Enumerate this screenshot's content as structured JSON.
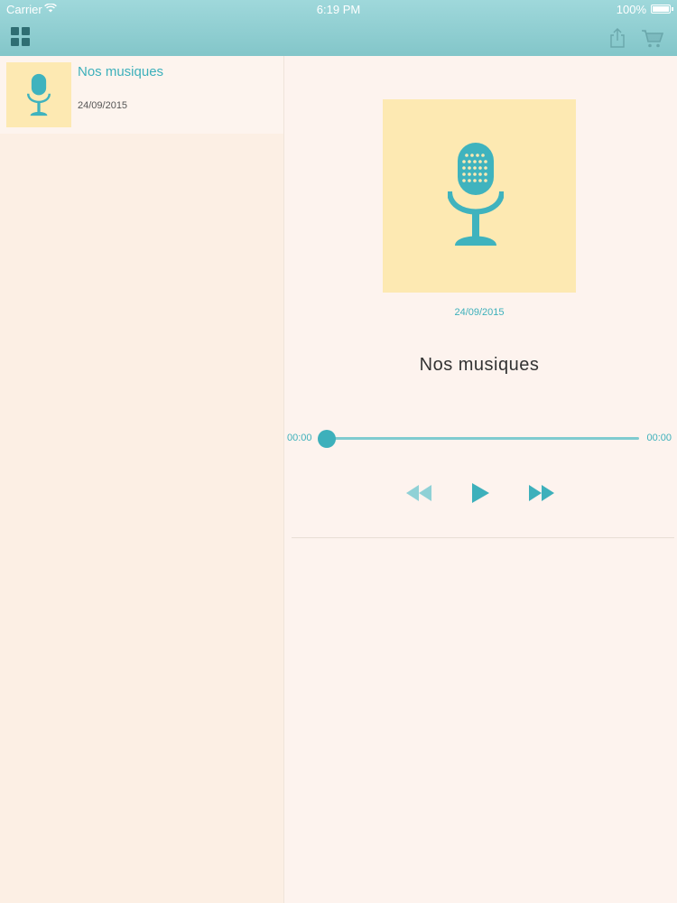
{
  "status_bar": {
    "carrier": "Carrier",
    "time": "6:19 PM",
    "battery": "100%"
  },
  "toolbar": {
    "menu_icon": "grid-icon",
    "share_icon": "share-icon",
    "cart_icon": "cart-icon"
  },
  "sidebar": {
    "items": [
      {
        "title": "Nos musiques",
        "date": "24/09/2015",
        "icon": "microphone-icon"
      }
    ]
  },
  "player": {
    "date": "24/09/2015",
    "title": "Nos musiques",
    "time_elapsed": "00:00",
    "time_total": "00:00",
    "progress": 0,
    "controls": [
      "rewind-icon",
      "play-icon",
      "fast-forward-icon"
    ]
  },
  "colors": {
    "accent": "#3db0bb",
    "header": "#8fcdd0",
    "cover_background": "#fde9b2",
    "background": "#fdf3ec"
  }
}
